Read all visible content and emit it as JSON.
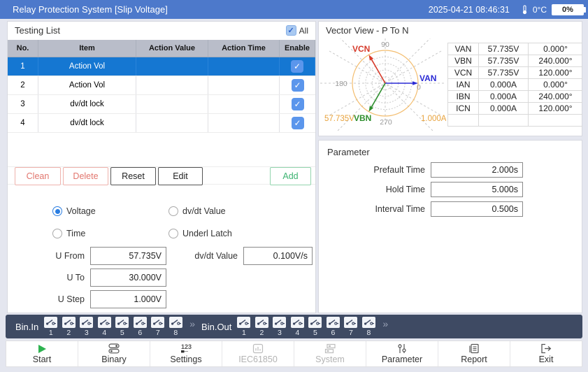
{
  "titlebar": {
    "title": "Relay Protection System [Slip Voltage]",
    "datetime": "2025-04-21 08:46:31",
    "temperature": "0°C",
    "battery": "0%"
  },
  "testing_list": {
    "title": "Testing List",
    "all_label": "All",
    "columns": [
      "No.",
      "Item",
      "Action Value",
      "Action Time",
      "Enable"
    ],
    "rows": [
      {
        "no": "1",
        "item": "Action Vol",
        "action_value": "",
        "action_time": "",
        "enabled": true,
        "selected": true
      },
      {
        "no": "2",
        "item": "Action Vol",
        "action_value": "",
        "action_time": "",
        "enabled": true,
        "selected": false
      },
      {
        "no": "3",
        "item": "dv/dt lock",
        "action_value": "",
        "action_time": "",
        "enabled": true,
        "selected": false
      },
      {
        "no": "4",
        "item": "dv/dt lock",
        "action_value": "",
        "action_time": "",
        "enabled": true,
        "selected": false
      }
    ],
    "buttons": {
      "clean": "Clean",
      "delete": "Delete",
      "reset": "Reset",
      "edit": "Edit",
      "add": "Add"
    },
    "radios": [
      {
        "label": "Voltage",
        "checked": true
      },
      {
        "label": "dv/dt Value",
        "checked": false
      },
      {
        "label": "Time",
        "checked": false
      },
      {
        "label": "Underl Latch",
        "checked": false
      }
    ],
    "fields": [
      {
        "label": "U From",
        "value": "57.735V"
      },
      {
        "label": "dv/dt Value",
        "value": "0.100V/s"
      },
      {
        "label": "U To",
        "value": "30.000V"
      },
      {
        "label": "U Step",
        "value": "1.000V"
      }
    ]
  },
  "vector_view": {
    "title": "Vector View - P To N",
    "angle_labels": [
      "90",
      "180",
      "270",
      "0"
    ],
    "scale_voltage": "57.735V",
    "scale_current": "1.000A",
    "vectors": [
      {
        "name": "VAN",
        "angle_deg": 0,
        "color": "#2b2bd5"
      },
      {
        "name": "VBN",
        "angle_deg": 240,
        "color": "#2f8f2f"
      },
      {
        "name": "VCN",
        "angle_deg": 120,
        "color": "#d63a2a"
      }
    ],
    "table": [
      {
        "name": "VAN",
        "value": "57.735V",
        "angle": "0.000°"
      },
      {
        "name": "VBN",
        "value": "57.735V",
        "angle": "240.000°"
      },
      {
        "name": "VCN",
        "value": "57.735V",
        "angle": "120.000°"
      },
      {
        "name": "IAN",
        "value": "0.000A",
        "angle": "0.000°"
      },
      {
        "name": "IBN",
        "value": "0.000A",
        "angle": "240.000°"
      },
      {
        "name": "ICN",
        "value": "0.000A",
        "angle": "120.000°"
      },
      {
        "name": "",
        "value": "",
        "angle": ""
      }
    ]
  },
  "parameter": {
    "title": "Parameter",
    "fields": [
      {
        "label": "Prefault Time",
        "value": "2.000s"
      },
      {
        "label": "Hold Time",
        "value": "5.000s"
      },
      {
        "label": "Interval Time",
        "value": "0.500s"
      }
    ]
  },
  "bin_bar": {
    "bin_in_label": "Bin.In",
    "bin_out_label": "Bin.Out",
    "channels": [
      "1",
      "2",
      "3",
      "4",
      "5",
      "6",
      "7",
      "8"
    ],
    "chevron": "»"
  },
  "toolbar": {
    "items": [
      {
        "label": "Start",
        "disabled": false
      },
      {
        "label": "Binary",
        "disabled": false
      },
      {
        "label": "Settings",
        "disabled": false
      },
      {
        "label": "IEC61850",
        "disabled": true
      },
      {
        "label": "System",
        "disabled": true
      },
      {
        "label": "Parameter",
        "disabled": false
      },
      {
        "label": "Report",
        "disabled": false
      },
      {
        "label": "Exit",
        "disabled": false
      }
    ]
  },
  "colors": {
    "titlebar_bg": "#4d79cb",
    "selected_row": "#1577d2",
    "checkbox_blue": "#5b96ec",
    "van": "#2b2bd5",
    "vbn": "#2f8f2f",
    "vcn": "#d63a2a",
    "polar_circle": "#f3bd6f",
    "scale_text": "#e8a33d",
    "danger": "#e2766e",
    "add_green": "#3cb371",
    "binbar_bg": "#3e4a63"
  }
}
